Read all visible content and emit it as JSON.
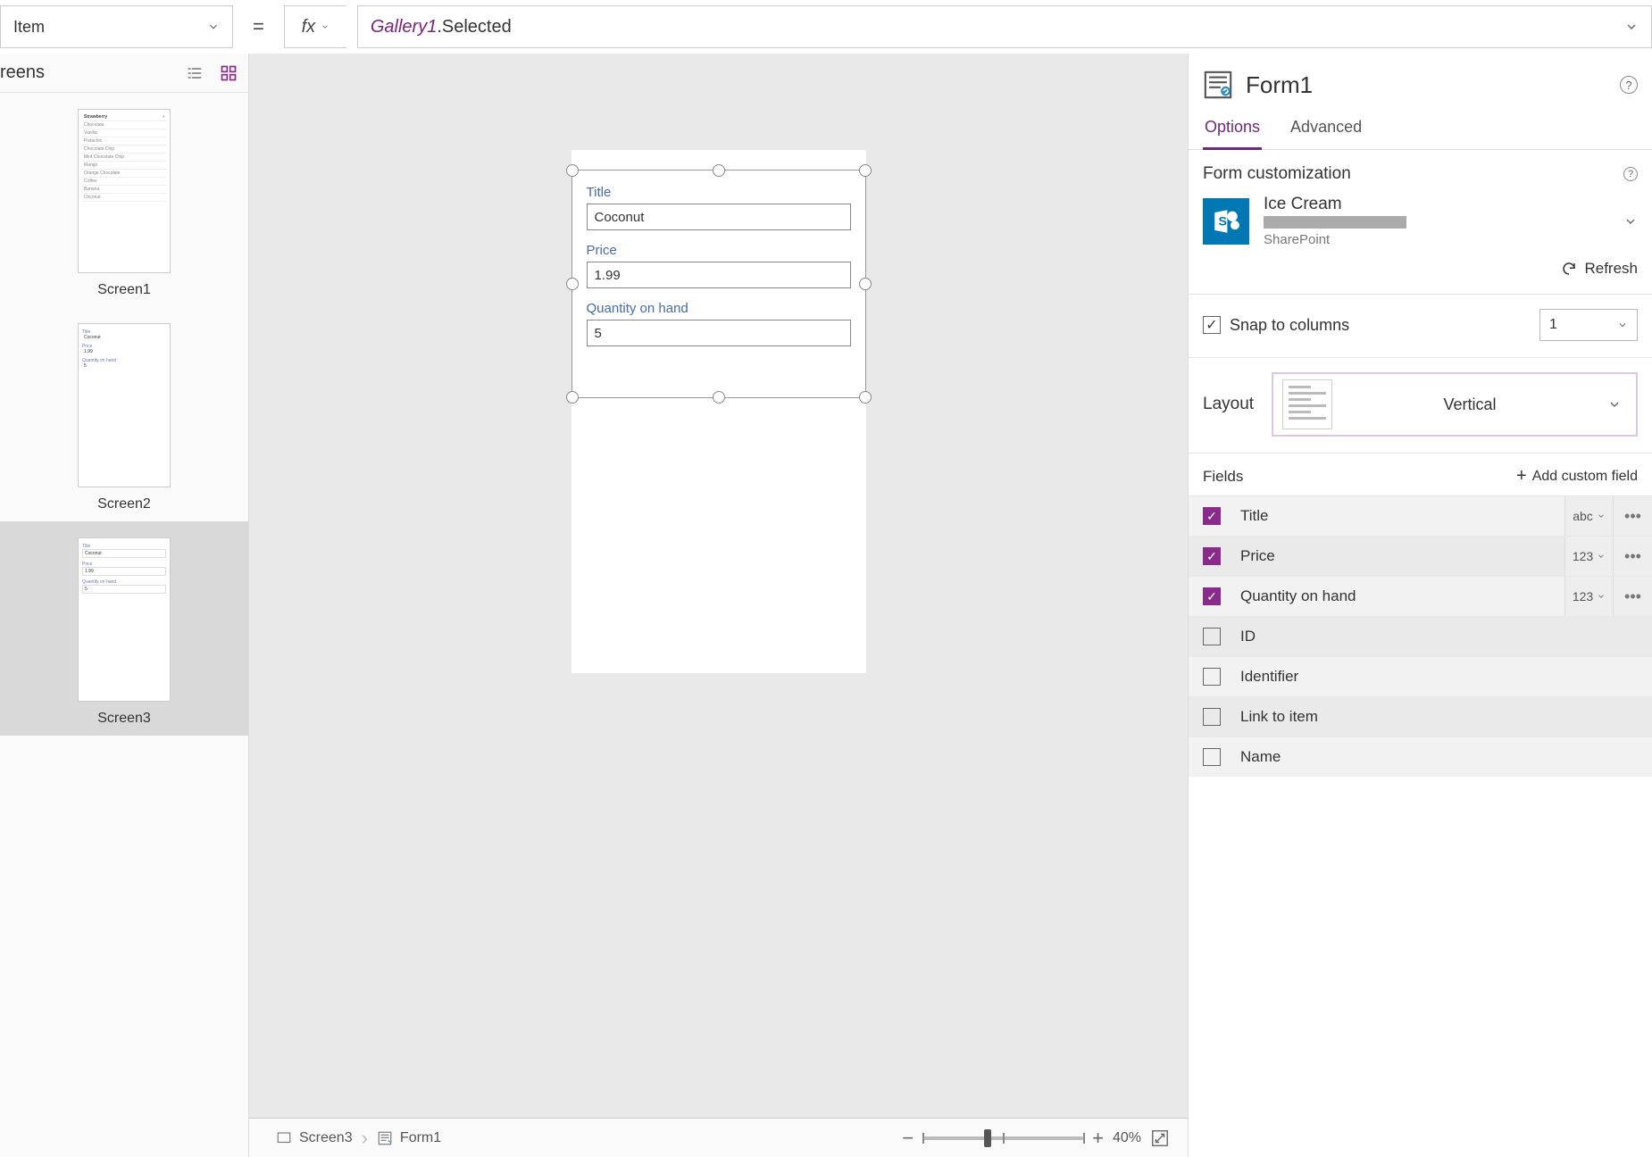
{
  "formula_bar": {
    "property": "Item",
    "fx_label": "fx",
    "expr_obj": "Gallery1",
    "expr_member": ".Selected"
  },
  "tree": {
    "header": "reens",
    "screens": [
      {
        "label": "Screen1"
      },
      {
        "label": "Screen2"
      },
      {
        "label": "Screen3"
      }
    ],
    "screen1_items": [
      "Strawberry",
      "Chocolate",
      "Vanilla",
      "Pistachio",
      "Chocolate Chip",
      "Mint Chocolate Chip",
      "Mango",
      "Orange Chocolate",
      "Coffee",
      "Banana",
      "Coconut"
    ],
    "form_preview": {
      "f1": "Title",
      "v1": "Coconut",
      "f2": "Price",
      "v2": "1.99",
      "f3": "Quantity on hand",
      "v3": "5"
    }
  },
  "canvas": {
    "fields": [
      {
        "label": "Title",
        "value": "Coconut"
      },
      {
        "label": "Price",
        "value": "1.99"
      },
      {
        "label": "Quantity on hand",
        "value": "5"
      }
    ]
  },
  "status": {
    "crumb1": "Screen3",
    "crumb2": "Form1",
    "zoom": "40%"
  },
  "props": {
    "title": "Form1",
    "tabs": {
      "options": "Options",
      "advanced": "Advanced"
    },
    "form_custom": "Form customization",
    "datasource": {
      "name": "Ice Cream",
      "provider": "SharePoint"
    },
    "refresh": "Refresh",
    "snap_label": "Snap to columns",
    "columns_value": "1",
    "layout_label": "Layout",
    "layout_value": "Vertical",
    "fields_label": "Fields",
    "add_field": "Add custom field",
    "fields": [
      {
        "name": "Title",
        "checked": true,
        "type": "abc"
      },
      {
        "name": "Price",
        "checked": true,
        "type": "123"
      },
      {
        "name": "Quantity on hand",
        "checked": true,
        "type": "123"
      },
      {
        "name": "ID",
        "checked": false
      },
      {
        "name": "Identifier",
        "checked": false
      },
      {
        "name": "Link to item",
        "checked": false
      },
      {
        "name": "Name",
        "checked": false
      }
    ]
  }
}
